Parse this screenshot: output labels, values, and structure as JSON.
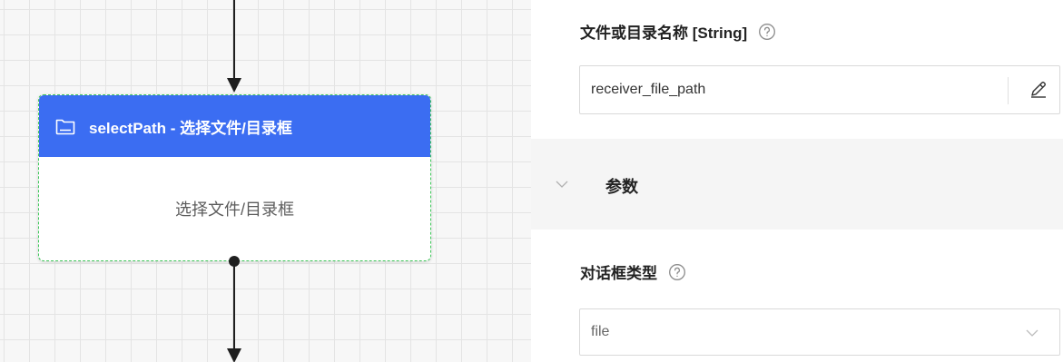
{
  "flow_node": {
    "title": "selectPath - 选择文件/目录框",
    "body_text": "选择文件/目录框",
    "header_color": "#3b6df2",
    "selection_border_color": "#3fc75a",
    "icon": "folder-icon"
  },
  "properties": {
    "name_field": {
      "label": "文件或目录名称 [String]",
      "value": "receiver_file_path",
      "help_icon": "question-circle-icon",
      "edit_icon": "pencil-icon"
    },
    "params_section": {
      "title": "参数",
      "chevron": "chevron-down-icon"
    },
    "dialog_type": {
      "label": "对话框类型",
      "value": "file",
      "help_icon": "question-circle-icon",
      "dropdown_icon": "chevron-down-icon"
    }
  }
}
